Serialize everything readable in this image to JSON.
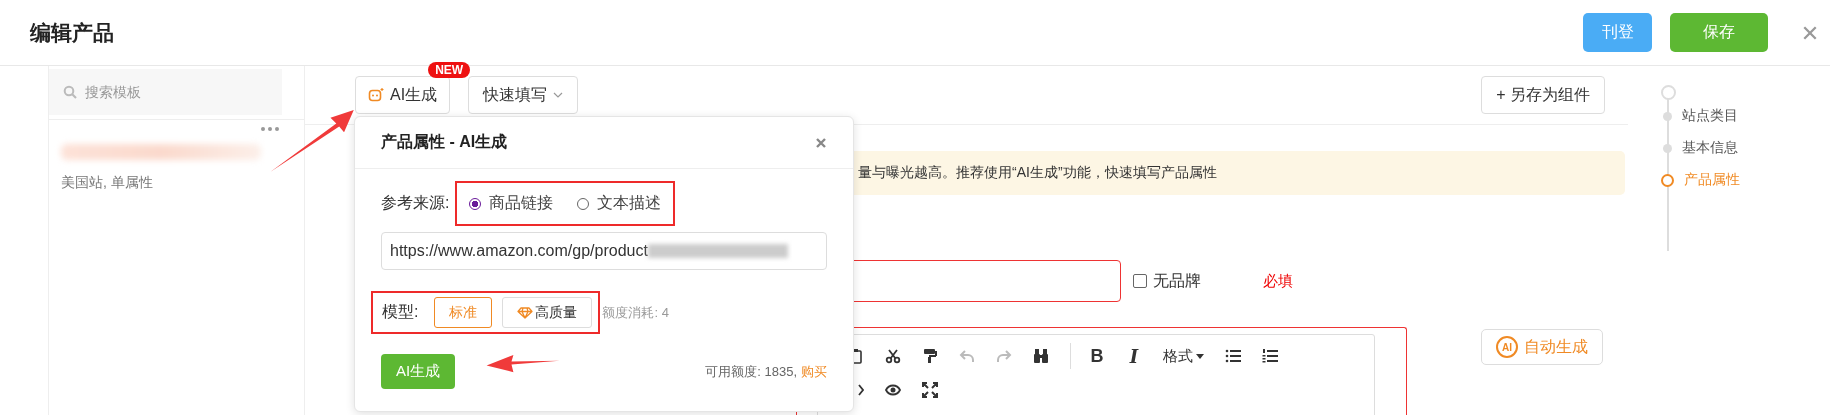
{
  "header": {
    "title": "编辑产品",
    "buttons": [
      {
        "label": "刊登",
        "kind": "publish"
      },
      {
        "label": "保存",
        "kind": "save"
      }
    ]
  },
  "sidebar": {
    "search": {
      "placeholder": "搜索模板"
    },
    "templates": [
      {
        "meta": "美国站, 单属性"
      }
    ]
  },
  "toolbar": {
    "ai_button": {
      "label": "AI生成",
      "badge": "NEW"
    },
    "quick_fill": {
      "label": "快速填写"
    },
    "save_component": {
      "label": "+ 另存为组件"
    }
  },
  "notice": {
    "text": "量与曝光越高。推荐使用“AI生成”功能，快速填写产品属性"
  },
  "brand": {
    "no_brand": {
      "label": "无品牌",
      "checked": false
    },
    "required": "必填"
  },
  "editor": {
    "rows": [
      [
        {
          "kind": "paste"
        },
        {
          "kind": "cut",
          "disabled": false
        },
        {
          "kind": "painter",
          "disabled": false
        },
        {
          "kind": "undo",
          "disabled": true
        },
        {
          "kind": "redo",
          "disabled": true
        },
        {
          "kind": "find",
          "disabled": false
        },
        {
          "kind": "separator"
        },
        {
          "kind": "bold",
          "glyph": "B"
        },
        {
          "kind": "italic",
          "glyph": "I"
        },
        {
          "kind": "menu",
          "label": "格式"
        },
        {
          "kind": "bullets",
          "disabled": false
        },
        {
          "kind": "numbers",
          "disabled": false
        }
      ],
      [
        {
          "kind": "code"
        },
        {
          "kind": "preview",
          "disabled": false
        },
        {
          "kind": "fullscreen",
          "disabled": false
        }
      ]
    ]
  },
  "auto_generate": {
    "badge": "AI",
    "label": "自动生成"
  },
  "steps": [
    {
      "label": "站点类目",
      "selected": false
    },
    {
      "label": "基本信息",
      "selected": false
    },
    {
      "label": "产品属性",
      "selected": true
    }
  ],
  "popup": {
    "title": "产品属性 - AI生成",
    "source_label": "参考来源:",
    "sources": [
      {
        "label": "商品链接",
        "selected": true
      },
      {
        "label": "文本描述",
        "selected": false
      }
    ],
    "url": "https://www.amazon.com/gp/product",
    "model_label": "模型:",
    "models": [
      {
        "label": "标准",
        "selected": true,
        "kind": "standard"
      },
      {
        "label": "高质量",
        "selected": false,
        "kind": "premium"
      }
    ],
    "cost": "额度消耗: 4",
    "generate": "AI生成",
    "credits": "可用额度: 1835,",
    "buy": "购买"
  }
}
